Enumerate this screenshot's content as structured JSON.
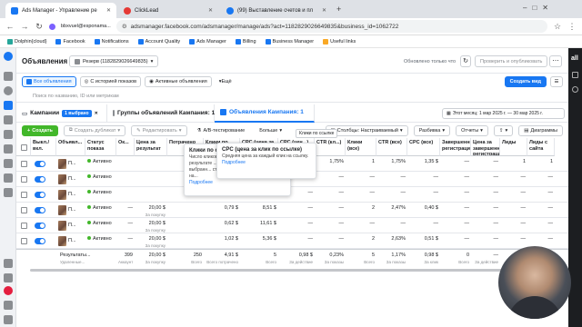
{
  "browser": {
    "tabs": [
      {
        "label": "Ads Manager - Управление ре",
        "active": true,
        "color": "#1877f2"
      },
      {
        "label": "ClickLead",
        "active": false,
        "color": "#e53935"
      },
      {
        "label": "(99) Выставление счетов и пл",
        "active": false,
        "color": "#1877f2"
      }
    ],
    "url": "adsmanager.facebook.com/adsmanager/manage/ads?act=1182829026649835&business_id=1062722",
    "profile": "bbxvuel@esponama...",
    "bookmarks": [
      "Dolphin{cloud}",
      "Facebook",
      "Notifications",
      "Account Quality",
      "Ads Manager",
      "Billing",
      "Business Manager",
      "Useful links"
    ]
  },
  "app": {
    "section_title": "Объявления",
    "account": "Резерв (1182829026649835)",
    "updated_text": "Обновлено только что",
    "review_btn": "Проверить и опубликовать",
    "create_view": "Создать вид",
    "filters": [
      "Все объявления",
      "С историей показов",
      "Активные объявления",
      "Ещё"
    ],
    "search_placeholder": "Поиск по названию, ID или метрикам",
    "date_range": "Этот месяц: 1 мар 2025 г. — 30 мар 2025 г."
  },
  "levels": {
    "campaigns": "Кампании",
    "campaigns_badge": "1 выбрано",
    "adsets": "Группы объявлений Кампания: 1",
    "ads": "Объявления Кампания: 1"
  },
  "actions": {
    "create": "Создать",
    "duplicate": "Создать дубликат",
    "edit": "Редактировать",
    "ab": "A/B-тестирование",
    "more": "Больше",
    "columns": "Столбцы: Настраиваемый",
    "breakdown": "Разбивка",
    "reports": "Отчеты",
    "charts": "Диаграммы"
  },
  "columns": [
    "Выкл./вкл.",
    "Объявл...",
    "Статус показа",
    "Ок...",
    "Цена за результат",
    "Потрачено",
    "Клики по ссылке",
    "CPC (цена за клик по ссылке)",
    "CPC (цен...)",
    "CTR (кл...)",
    "Клики (все)",
    "CTR (все)",
    "CPC (все)",
    "Завершенные регистрации",
    "Цена за завершенную регистрацию",
    "Лиды",
    "Лиды с сайта"
  ],
  "rows": [
    {
      "name": "П...",
      "status": "Активно",
      "ok": "",
      "cpr": "",
      "cpr_sub": "",
      "spent": "",
      "clicks": "",
      "cpc": "",
      "cpc2": "1,35 $",
      "ctr": "1,75%",
      "clicks_all": "1",
      "ctr_all": "1,75%",
      "cpc_all": "1,35 $",
      "reg": "—",
      "reg_cost": "—",
      "leads": "1",
      "site_leads": "1"
    },
    {
      "name": "П...",
      "status": "Активно",
      "ok": "",
      "cpr": "",
      "cpr_sub": "",
      "spent": "",
      "clicks": "",
      "cpc": "",
      "cpc2": "—",
      "ctr": "—",
      "clicks_all": "—",
      "ctr_all": "—",
      "cpc_all": "—",
      "reg": "—",
      "reg_cost": "—",
      "leads": "—",
      "site_leads": "—"
    },
    {
      "name": "П...",
      "status": "Активно",
      "ok": "",
      "cpr": "",
      "cpr_sub": "",
      "spent": "",
      "clicks": "",
      "cpc": "",
      "cpc2": "—",
      "ctr": "—",
      "clicks_all": "—",
      "ctr_all": "—",
      "cpc_all": "—",
      "reg": "—",
      "reg_cost": "—",
      "leads": "—",
      "site_leads": "—"
    },
    {
      "name": "П...",
      "status": "Активно",
      "ok": "—",
      "cpr": "20,00 $",
      "cpr_sub": "За покупку",
      "spent": "0,79 $",
      "clicks": "8,51 $",
      "cpc": "—",
      "cpc2": "—",
      "ctr": "—",
      "clicks_all": "2",
      "ctr_all": "2,47%",
      "cpc_all": "0,40 $",
      "reg": "—",
      "reg_cost": "—",
      "leads": "—",
      "site_leads": "—"
    },
    {
      "name": "П...",
      "status": "Активно",
      "ok": "—",
      "cpr": "20,00 $",
      "cpr_sub": "За покупку",
      "spent": "0,62 $",
      "clicks": "11,61 $",
      "cpc": "—",
      "cpc2": "—",
      "ctr": "—",
      "clicks_all": "—",
      "ctr_all": "—",
      "cpc_all": "—",
      "reg": "—",
      "reg_cost": "—",
      "leads": "—",
      "site_leads": "—"
    },
    {
      "name": "П...",
      "status": "Активно",
      "ok": "—",
      "cpr": "20,00 $",
      "cpr_sub": "За покупку",
      "spent": "1,02 $",
      "clicks": "5,36 $",
      "cpc": "—",
      "cpc2": "—",
      "ctr": "—",
      "clicks_all": "2",
      "ctr_all": "2,63%",
      "cpc_all": "0,51 $",
      "reg": "—",
      "reg_cost": "—",
      "leads": "—",
      "site_leads": "—"
    }
  ],
  "totals": {
    "name": "Результаты...",
    "name_sub": "Удаленные...",
    "ok": "399",
    "ok_sub": "Аккаунт",
    "cpr": "20,00 $",
    "cpr_sub": "За покупку",
    "reach": "250",
    "reach_sub": "Всего",
    "spent": "4,91 $",
    "spent_sub": "Всего потрачено",
    "clicks": "5",
    "clicks_sub": "Всего",
    "cpc": "0,98 $",
    "cpc_sub": "За действие",
    "ctr": "0,23%",
    "ctr_sub": "За показы",
    "clicks_all": "5",
    "clicks_all_sub": "Всего",
    "ctr_all": "1,17%",
    "ctr_all_sub": "За показы",
    "cpc_all": "0,98 $",
    "cpc_all_sub": "За клик",
    "reg": "0",
    "reg_sub": "Всего",
    "reg_cost": "—",
    "reg_cost_sub": "За действие",
    "leads": "1",
    "leads_sub": "Всего",
    "site_leads": "1",
    "site_leads_sub": "Всего"
  },
  "tooltip_left": {
    "title": "Клики по с...",
    "body": "Число кликов... результате ... на выбранн... страница на...",
    "more": "Подробнее"
  },
  "tooltip_right": {
    "title": "CPC (цена за клик по ссылке)",
    "body": "Средняя цена за каждый клик на ссылку.",
    "more": "Подробнее"
  },
  "small_tip": "Клики по ссылке",
  "colors": {
    "accent": "#1877f2",
    "green": "#42b72a",
    "text": "#1c1e21",
    "muted": "#8a8d91"
  }
}
